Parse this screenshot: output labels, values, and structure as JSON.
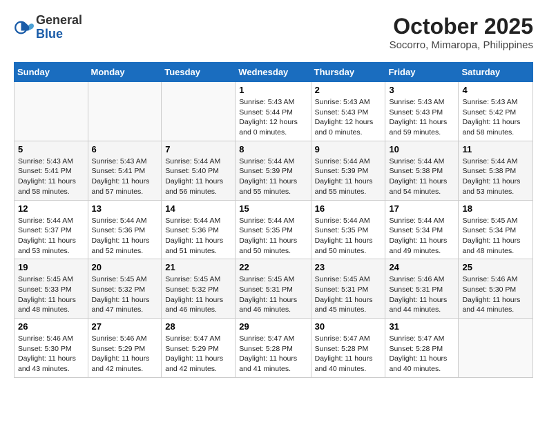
{
  "header": {
    "logo_general": "General",
    "logo_blue": "Blue",
    "month": "October 2025",
    "location": "Socorro, Mimaropa, Philippines"
  },
  "days_of_week": [
    "Sunday",
    "Monday",
    "Tuesday",
    "Wednesday",
    "Thursday",
    "Friday",
    "Saturday"
  ],
  "weeks": [
    [
      {
        "day": "",
        "info": ""
      },
      {
        "day": "",
        "info": ""
      },
      {
        "day": "",
        "info": ""
      },
      {
        "day": "1",
        "info": "Sunrise: 5:43 AM\nSunset: 5:44 PM\nDaylight: 12 hours\nand 0 minutes."
      },
      {
        "day": "2",
        "info": "Sunrise: 5:43 AM\nSunset: 5:43 PM\nDaylight: 12 hours\nand 0 minutes."
      },
      {
        "day": "3",
        "info": "Sunrise: 5:43 AM\nSunset: 5:43 PM\nDaylight: 11 hours\nand 59 minutes."
      },
      {
        "day": "4",
        "info": "Sunrise: 5:43 AM\nSunset: 5:42 PM\nDaylight: 11 hours\nand 58 minutes."
      }
    ],
    [
      {
        "day": "5",
        "info": "Sunrise: 5:43 AM\nSunset: 5:41 PM\nDaylight: 11 hours\nand 58 minutes."
      },
      {
        "day": "6",
        "info": "Sunrise: 5:43 AM\nSunset: 5:41 PM\nDaylight: 11 hours\nand 57 minutes."
      },
      {
        "day": "7",
        "info": "Sunrise: 5:44 AM\nSunset: 5:40 PM\nDaylight: 11 hours\nand 56 minutes."
      },
      {
        "day": "8",
        "info": "Sunrise: 5:44 AM\nSunset: 5:39 PM\nDaylight: 11 hours\nand 55 minutes."
      },
      {
        "day": "9",
        "info": "Sunrise: 5:44 AM\nSunset: 5:39 PM\nDaylight: 11 hours\nand 55 minutes."
      },
      {
        "day": "10",
        "info": "Sunrise: 5:44 AM\nSunset: 5:38 PM\nDaylight: 11 hours\nand 54 minutes."
      },
      {
        "day": "11",
        "info": "Sunrise: 5:44 AM\nSunset: 5:38 PM\nDaylight: 11 hours\nand 53 minutes."
      }
    ],
    [
      {
        "day": "12",
        "info": "Sunrise: 5:44 AM\nSunset: 5:37 PM\nDaylight: 11 hours\nand 53 minutes."
      },
      {
        "day": "13",
        "info": "Sunrise: 5:44 AM\nSunset: 5:36 PM\nDaylight: 11 hours\nand 52 minutes."
      },
      {
        "day": "14",
        "info": "Sunrise: 5:44 AM\nSunset: 5:36 PM\nDaylight: 11 hours\nand 51 minutes."
      },
      {
        "day": "15",
        "info": "Sunrise: 5:44 AM\nSunset: 5:35 PM\nDaylight: 11 hours\nand 50 minutes."
      },
      {
        "day": "16",
        "info": "Sunrise: 5:44 AM\nSunset: 5:35 PM\nDaylight: 11 hours\nand 50 minutes."
      },
      {
        "day": "17",
        "info": "Sunrise: 5:44 AM\nSunset: 5:34 PM\nDaylight: 11 hours\nand 49 minutes."
      },
      {
        "day": "18",
        "info": "Sunrise: 5:45 AM\nSunset: 5:34 PM\nDaylight: 11 hours\nand 48 minutes."
      }
    ],
    [
      {
        "day": "19",
        "info": "Sunrise: 5:45 AM\nSunset: 5:33 PM\nDaylight: 11 hours\nand 48 minutes."
      },
      {
        "day": "20",
        "info": "Sunrise: 5:45 AM\nSunset: 5:32 PM\nDaylight: 11 hours\nand 47 minutes."
      },
      {
        "day": "21",
        "info": "Sunrise: 5:45 AM\nSunset: 5:32 PM\nDaylight: 11 hours\nand 46 minutes."
      },
      {
        "day": "22",
        "info": "Sunrise: 5:45 AM\nSunset: 5:31 PM\nDaylight: 11 hours\nand 46 minutes."
      },
      {
        "day": "23",
        "info": "Sunrise: 5:45 AM\nSunset: 5:31 PM\nDaylight: 11 hours\nand 45 minutes."
      },
      {
        "day": "24",
        "info": "Sunrise: 5:46 AM\nSunset: 5:31 PM\nDaylight: 11 hours\nand 44 minutes."
      },
      {
        "day": "25",
        "info": "Sunrise: 5:46 AM\nSunset: 5:30 PM\nDaylight: 11 hours\nand 44 minutes."
      }
    ],
    [
      {
        "day": "26",
        "info": "Sunrise: 5:46 AM\nSunset: 5:30 PM\nDaylight: 11 hours\nand 43 minutes."
      },
      {
        "day": "27",
        "info": "Sunrise: 5:46 AM\nSunset: 5:29 PM\nDaylight: 11 hours\nand 42 minutes."
      },
      {
        "day": "28",
        "info": "Sunrise: 5:47 AM\nSunset: 5:29 PM\nDaylight: 11 hours\nand 42 minutes."
      },
      {
        "day": "29",
        "info": "Sunrise: 5:47 AM\nSunset: 5:28 PM\nDaylight: 11 hours\nand 41 minutes."
      },
      {
        "day": "30",
        "info": "Sunrise: 5:47 AM\nSunset: 5:28 PM\nDaylight: 11 hours\nand 40 minutes."
      },
      {
        "day": "31",
        "info": "Sunrise: 5:47 AM\nSunset: 5:28 PM\nDaylight: 11 hours\nand 40 minutes."
      },
      {
        "day": "",
        "info": ""
      }
    ]
  ]
}
